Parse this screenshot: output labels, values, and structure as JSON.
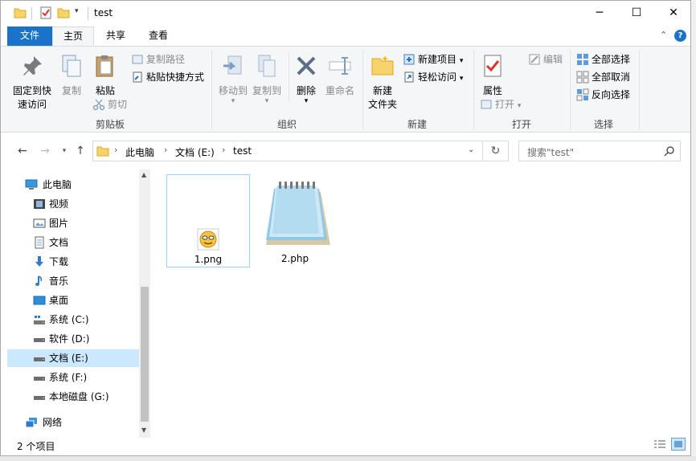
{
  "window": {
    "title": "test"
  },
  "window_controls": {
    "minimize": "─",
    "maximize": "☐",
    "close": "✕"
  },
  "tabs": [
    {
      "label": "文件"
    },
    {
      "label": "主页"
    },
    {
      "label": "共享"
    },
    {
      "label": "查看"
    }
  ],
  "ribbon": {
    "clipboard": {
      "label": "剪贴板",
      "pin": "固定到快\n速访问",
      "pin_l1": "固定到快",
      "pin_l2": "速访问",
      "copy": "复制",
      "paste": "粘贴",
      "copy_path": "复制路径",
      "paste_shortcut": "粘贴快捷方式",
      "cut": "剪切"
    },
    "organize": {
      "label": "组织",
      "move_to": "移动到",
      "copy_to": "复制到",
      "delete": "删除",
      "rename": "重命名"
    },
    "new": {
      "label": "新建",
      "new_folder_l1": "新建",
      "new_folder_l2": "文件夹",
      "new_item": "新建项目",
      "easy_access": "轻松访问"
    },
    "open": {
      "label": "打开",
      "properties": "属性",
      "open": "打开",
      "edit": "编辑"
    },
    "select": {
      "label": "选择",
      "select_all": "全部选择",
      "select_none": "全部取消",
      "invert": "反向选择"
    }
  },
  "address": {
    "crumbs": [
      "此电脑",
      "文档 (E:)",
      "test"
    ],
    "search_placeholder": "搜索\"test\""
  },
  "nav": [
    {
      "label": "此电脑",
      "icon": "computer-icon"
    },
    {
      "label": "视频",
      "icon": "video-icon"
    },
    {
      "label": "图片",
      "icon": "picture-icon"
    },
    {
      "label": "文档",
      "icon": "document-icon"
    },
    {
      "label": "下载",
      "icon": "download-icon"
    },
    {
      "label": "音乐",
      "icon": "music-icon"
    },
    {
      "label": "桌面",
      "icon": "desktop-icon"
    },
    {
      "label": "系统 (C:)",
      "icon": "drive-c-icon"
    },
    {
      "label": "软件 (D:)",
      "icon": "drive-icon"
    },
    {
      "label": "文档 (E:)",
      "icon": "drive-icon",
      "selected": true
    },
    {
      "label": "系统 (F:)",
      "icon": "drive-icon"
    },
    {
      "label": "本地磁盘 (G:)",
      "icon": "drive-icon"
    },
    {
      "label": "网络",
      "icon": "network-icon"
    }
  ],
  "files": [
    {
      "name": "1.png",
      "icon": "png-image-icon",
      "selected": true
    },
    {
      "name": "2.php",
      "icon": "notepad-icon"
    }
  ],
  "status": {
    "count": "2 个项目"
  },
  "colors": {
    "accent": "#1a73c8",
    "selection": "#cce8ff",
    "selection_border": "#99d1ff"
  }
}
